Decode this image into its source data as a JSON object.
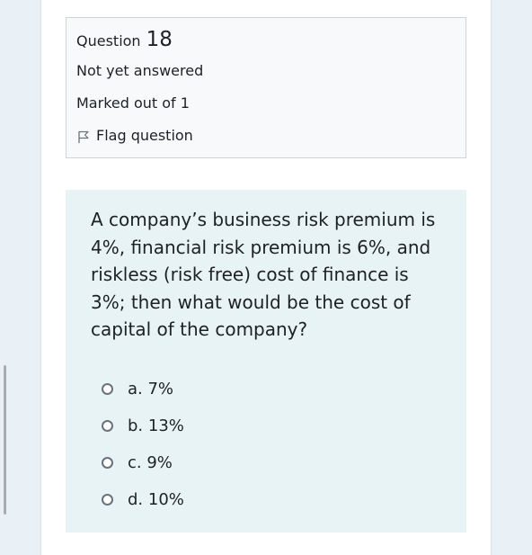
{
  "question_info": {
    "label": "Question",
    "number": "18",
    "state": "Not yet answered",
    "grade": "Marked out of 1",
    "flag_label": "Flag question"
  },
  "question": {
    "text": "A company’s business risk premium is 4%, financial risk premium is 6%, and riskless (risk free) cost of finance is 3%; then what would be the cost of capital of the company?",
    "answers": [
      {
        "label": "a. 7%"
      },
      {
        "label": "b. 13%"
      },
      {
        "label": "c. 9%"
      },
      {
        "label": "d. 10%"
      }
    ]
  },
  "icons": {
    "flag": "flag-outline-icon",
    "radio": "radio-unchecked"
  },
  "colors": {
    "page_background": "#e9f1f6",
    "info_box_background": "#f8f9fa",
    "question_box_background": "#e7f3f5",
    "text": "#1d2125"
  }
}
